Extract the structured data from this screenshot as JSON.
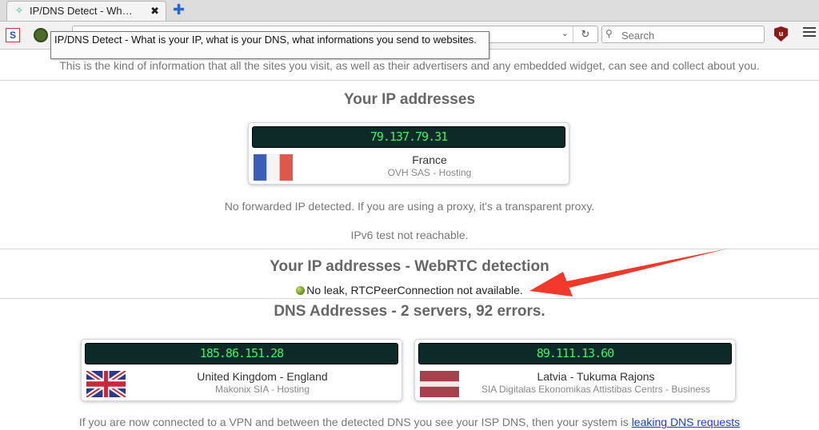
{
  "browser": {
    "tab_title": "IP/DNS Detect - Wh…",
    "tab_close": "✖",
    "new_tab": "✚",
    "url_value": "",
    "search_placeholder": "Search",
    "tooltip": "IP/DNS Detect - What is your IP, what is your DNS, what informations you send to websites."
  },
  "page": {
    "intro": "This is the kind of information that all the sites you visit, as well as their advertisers and any embedded widget, can see and collect about you.",
    "ip_section": {
      "title": "Your IP addresses",
      "ip": "79.137.79.31",
      "country": "France",
      "isp": "OVH SAS - Hosting",
      "flag": "france-flag"
    },
    "forwarded_note": "No forwarded IP detected. If you are using a proxy, it's a transparent proxy.",
    "ipv6_note": "IPv6 test not reachable.",
    "webrtc_section": {
      "title": "Your IP addresses - WebRTC detection",
      "status": "No leak, RTCPeerConnection not available."
    },
    "dns_section": {
      "title": "DNS Addresses - 2 servers, 92 errors.",
      "servers": [
        {
          "ip": "185.86.151.28",
          "country": "United Kingdom - England",
          "isp": "Makonix SIA - Hosting",
          "flag": "uk-flag"
        },
        {
          "ip": "89.111.13.60",
          "country": "Latvia - Tukuma Rajons",
          "isp": "SIA Digitalas Ekonomikas Attistibas Centrs - Business",
          "flag": "latvia-flag"
        }
      ]
    },
    "footer": {
      "text": "If you are now connected to a VPN and between the detected DNS you see your ISP DNS, then your system is ",
      "link": "leaking DNS requests"
    }
  },
  "colors": {
    "ip_bar_bg": "#0e2a28",
    "ip_text": "#3cf26a",
    "annotation_arrow": "#f0392b",
    "link": "#1a3ed6"
  }
}
